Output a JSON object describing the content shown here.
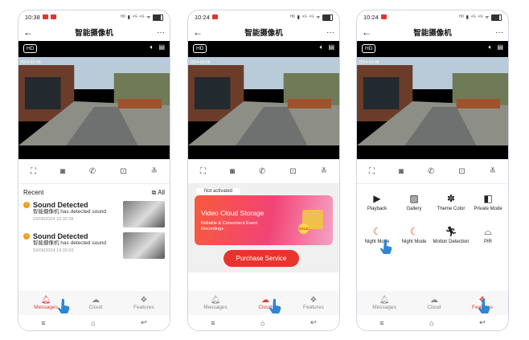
{
  "screens": [
    {
      "status_time": "10:38",
      "status_icons": "ᴴᴰ ▮ ⁴ᴳ ⁴ᴳ ᯤ",
      "title": "智能摄像机",
      "hd_label": "HD",
      "timestamp": "2024-03-06",
      "recent": {
        "header": "Recent",
        "all_label": "All"
      },
      "events": [
        {
          "title": "Sound Detected",
          "desc": "智能摄像机 has detected sound",
          "time": "03/06/2024 10:33:28"
        },
        {
          "title": "Sound Detected",
          "desc": "智能摄像机 has detected sound",
          "time": "03/06/2024 10:32:03"
        }
      ],
      "active_tab": "Messages"
    },
    {
      "status_time": "10:24",
      "status_icons": "ᴴᴰ ▮ ⁴ᴳ ⁴ᴳ ᯤ",
      "title": "智能摄像机",
      "hd_label": "HD",
      "timestamp": "2024-03-06",
      "cloud": {
        "not_activated": "Not activated",
        "banner_title": "Video Cloud Storage",
        "banner_subtitle": "Reliable & Convenient Event Recordings",
        "sale": "SALE",
        "purchase_label": "Purchase Service"
      },
      "active_tab": "Cloud"
    },
    {
      "status_time": "10:24",
      "status_icons": "ᴴᴰ ▮ ⁴ᴳ ⁴ᴳ ᯤ",
      "title": "智能摄像机",
      "hd_label": "HD",
      "timestamp": "2024-03-06",
      "features": [
        {
          "label": "Playback",
          "icon": "play-icon"
        },
        {
          "label": "Gallery",
          "icon": "gallery-icon"
        },
        {
          "label": "Theme Color",
          "icon": "palette-icon"
        },
        {
          "label": "Private Mode",
          "icon": "shield-icon"
        },
        {
          "label": "Night Mode",
          "icon": "night-mode-icon"
        },
        {
          "label": "Night Mode",
          "icon": "night-mode-icon"
        },
        {
          "label": "Motion Detection",
          "icon": "motion-icon"
        },
        {
          "label": "PIR",
          "icon": "pir-icon"
        }
      ],
      "active_tab": "Features"
    }
  ],
  "tabs": {
    "messages": "Messages",
    "cloud": "Cloud",
    "features": "Features"
  },
  "colors": {
    "accent": "#e03a2f",
    "banner_start": "#f75a3d",
    "banner_end": "#f5a2c4",
    "event_dot": "#f29a1d"
  }
}
